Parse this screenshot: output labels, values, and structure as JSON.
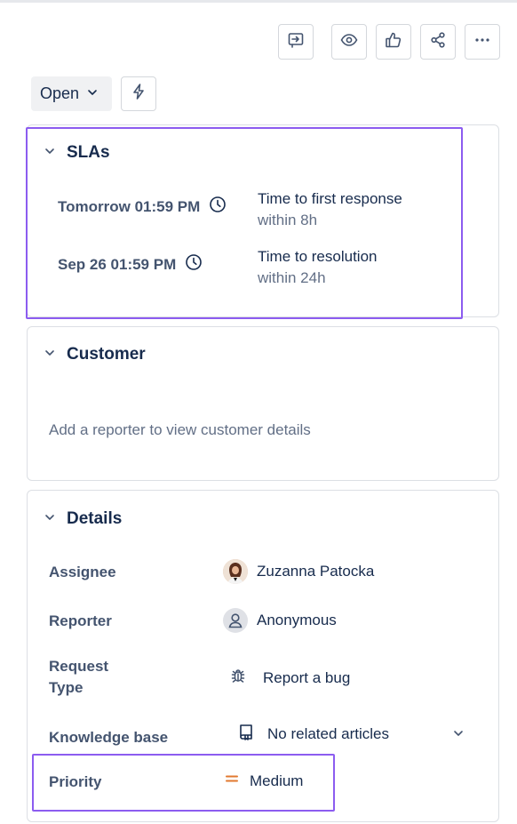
{
  "toolbar": {
    "icons": [
      "feedback-icon",
      "watch-eye-icon",
      "thumbs-up-icon",
      "share-icon",
      "more-icon"
    ],
    "status_label": "Open"
  },
  "sla": {
    "title": "SLAs",
    "items": [
      {
        "when": "Tomorrow 01:59 PM",
        "goal": "Time to first response",
        "within": "within 8h"
      },
      {
        "when": "Sep 26 01:59 PM",
        "goal": "Time to resolution",
        "within": "within 24h"
      }
    ]
  },
  "customer": {
    "title": "Customer",
    "empty_text": "Add a reporter to view customer details"
  },
  "details": {
    "title": "Details",
    "fields": {
      "assignee": {
        "label": "Assignee",
        "value": "Zuzanna Patocka"
      },
      "reporter": {
        "label": "Reporter",
        "value": "Anonymous"
      },
      "request_type": {
        "label_line1": "Request",
        "label_line2": "Type",
        "value": "Report a bug"
      },
      "knowledge_base": {
        "label": "Knowledge base",
        "value": "No related articles"
      },
      "priority": {
        "label": "Priority",
        "value": "Medium"
      }
    }
  },
  "colors": {
    "highlight": "#8c5cf0",
    "priority_medium": "#e2792f",
    "text": "#172b4d",
    "muted": "#626f86"
  }
}
